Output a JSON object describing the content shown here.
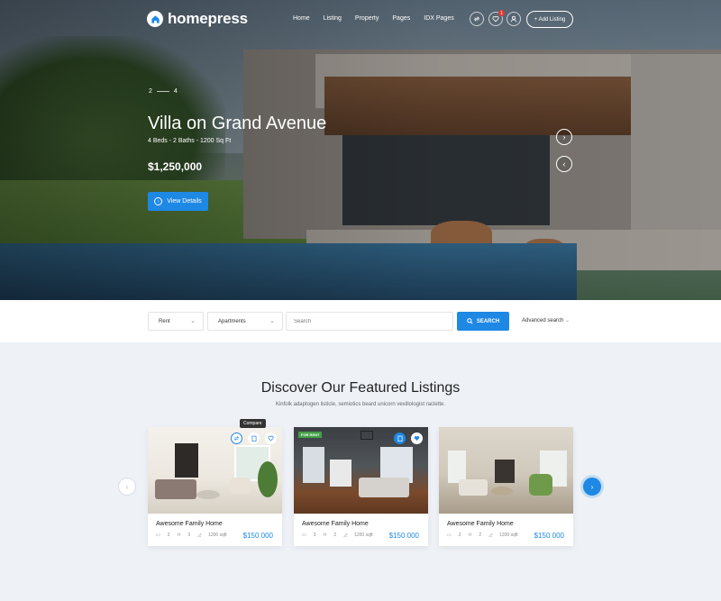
{
  "header": {
    "logo_text": "homepress",
    "nav": [
      "Home",
      "Listing",
      "Property",
      "Pages",
      "IDX Pages"
    ],
    "favorites_count": "1",
    "add_listing_label": "+ Add Listing"
  },
  "hero": {
    "slide_current": "2",
    "slide_total": "4",
    "title": "Villa on Grand Avenue",
    "details": "4 Beds - 2 Baths - 1200 Sq Ft",
    "price": "$1,250,000",
    "cta_label": "View Details"
  },
  "search": {
    "type_value": "Rent",
    "category_value": "Apartments",
    "placeholder": "Search",
    "button_label": "SEARCH",
    "advanced_label": "Advanced search"
  },
  "featured": {
    "title": "Discover Our Featured Listings",
    "subtitle": "Kinfolk adaptogen listicle, semiotics beard unicorn vexillologist raclette.",
    "compare_tooltip": "Compare",
    "cards": [
      {
        "name": "Awesome Family Home",
        "beds": "2",
        "baths": "3",
        "area": "1200 sqft",
        "price": "$150 000",
        "tag": ""
      },
      {
        "name": "Awesome Family Home",
        "beds": "3",
        "baths": "2",
        "area": "1200 sqft",
        "price": "$150 000",
        "tag": "FOR RENT"
      },
      {
        "name": "Awesome Family Home",
        "beds": "2",
        "baths": "2",
        "area": "1200 sqft",
        "price": "$150 000",
        "tag": ""
      }
    ]
  },
  "colors": {
    "accent": "#1e88e5",
    "badge_red": "#e53935",
    "tag_green": "#43a047",
    "section_bg": "#eef2f7"
  },
  "icons": [
    "home-logo-icon",
    "compare-icon",
    "heart-icon",
    "user-icon",
    "chevron-right-icon",
    "chevron-left-icon",
    "search-icon",
    "bed-icon",
    "bath-icon",
    "area-icon",
    "clipboard-icon"
  ]
}
